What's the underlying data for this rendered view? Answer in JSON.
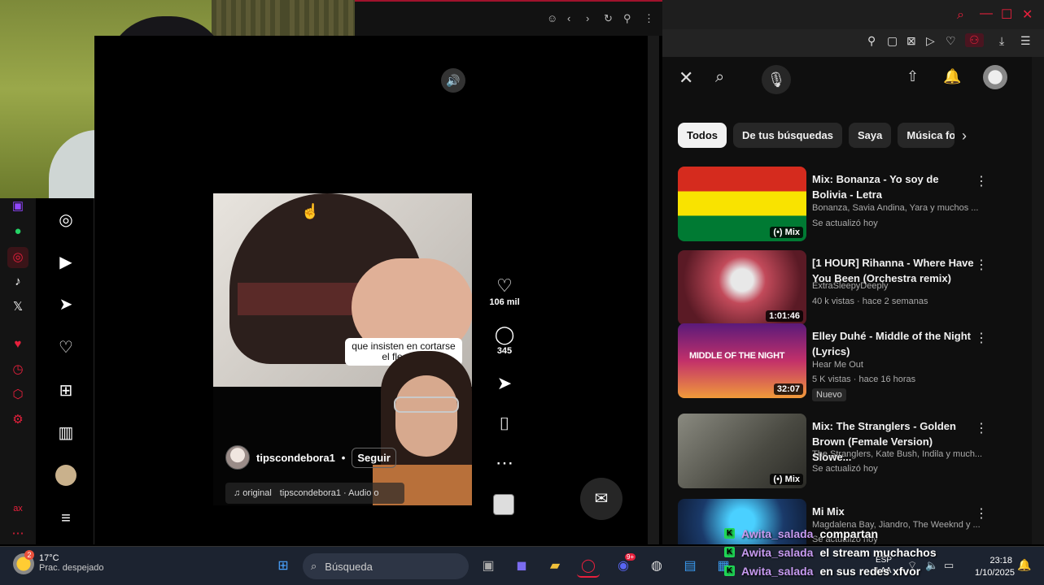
{
  "colors": {
    "accent_red": "#e8203c",
    "instagram_bg": "#000000",
    "youtube_bg": "#0f0f0f",
    "chip_active": "#f1f1f1",
    "chat_user": "#c79af0",
    "kick_green": "#1fd655"
  },
  "browser_toolbar_icons": [
    "smile-icon",
    "back-icon",
    "forward-icon",
    "reload-icon",
    "pin-icon",
    "menu-dots-icon"
  ],
  "opera_sidebar_icons": [
    "twitch-icon",
    "whatsapp-icon",
    "instagram-icon",
    "tiktok-icon",
    "x-icon",
    "heart-icon",
    "history-icon",
    "extensions-icon",
    "settings-icon",
    "aria-icon",
    "more-icon"
  ],
  "instagram_nav_icons": [
    "explore-icon",
    "reels-icon",
    "direct-icon",
    "notifications-icon",
    "create-icon",
    "dashboard-icon",
    "profile-avatar",
    "more-menu-icon"
  ],
  "reel": {
    "caption_overlay": "que insisten en cortarse el flequillo",
    "username": "tipscondebora1",
    "separator": "•",
    "follow": "Seguir",
    "audio_tag": "♫ original",
    "audio_title": "tipscondebora1 · Audio o",
    "likes": "106 mil",
    "comments": "345"
  },
  "youtube": {
    "chips": [
      "Todos",
      "De tus búsquedas",
      "Saya",
      "Música fo"
    ],
    "videos": [
      {
        "title": "Mix: Bonanza - Yo soy de Bolivia - Letra",
        "meta1": "Bonanza, Savia Andina, Yara y muchos ...",
        "meta2": "Se actualizó hoy",
        "badge": "(•) Mix"
      },
      {
        "title": "[1 HOUR] Rihanna - Where Have You Been (Orchestra remix)",
        "meta1": "ExtraSleepyDeeply",
        "meta2": "40 k vistas · hace 2 semanas",
        "badge": "1:01:46"
      },
      {
        "title": "Elley Duhé - Middle of the Night (Lyrics)",
        "meta1": "Hear Me Out",
        "meta2": "5 K vistas · hace 16 horas",
        "badge": "32:07",
        "label": "Nuevo",
        "thumb_text": "MIDDLE OF THE NIGHT"
      },
      {
        "title": "Mix: The Stranglers - Golden Brown (Female Version) Slowe...",
        "meta1": "The Stranglers, Kate Bush, Indila y much...",
        "meta2": "Se actualizó hoy",
        "badge": "(•) Mix"
      },
      {
        "title": "Mi Mix",
        "meta1": "Magdalena Bay, Jiandro, The Weeknd y ...",
        "meta2": "Se actualizó hoy"
      }
    ]
  },
  "chat": [
    {
      "user": "Awita_salada",
      "message": "compartan"
    },
    {
      "user": "Awita_salada",
      "message": "el stream muchachos"
    },
    {
      "user": "Awita_salada",
      "message": "en sus redes xfvor"
    }
  ],
  "taskbar": {
    "weather_badge": "2",
    "temperature": "17°C",
    "weather_desc": "Prac. despejado",
    "search_placeholder": "Búsqueda",
    "lang_code": "ESP",
    "lang_region": "LAA",
    "time": "23:18",
    "date": "1/10/2025",
    "discord_badge": "9+"
  }
}
